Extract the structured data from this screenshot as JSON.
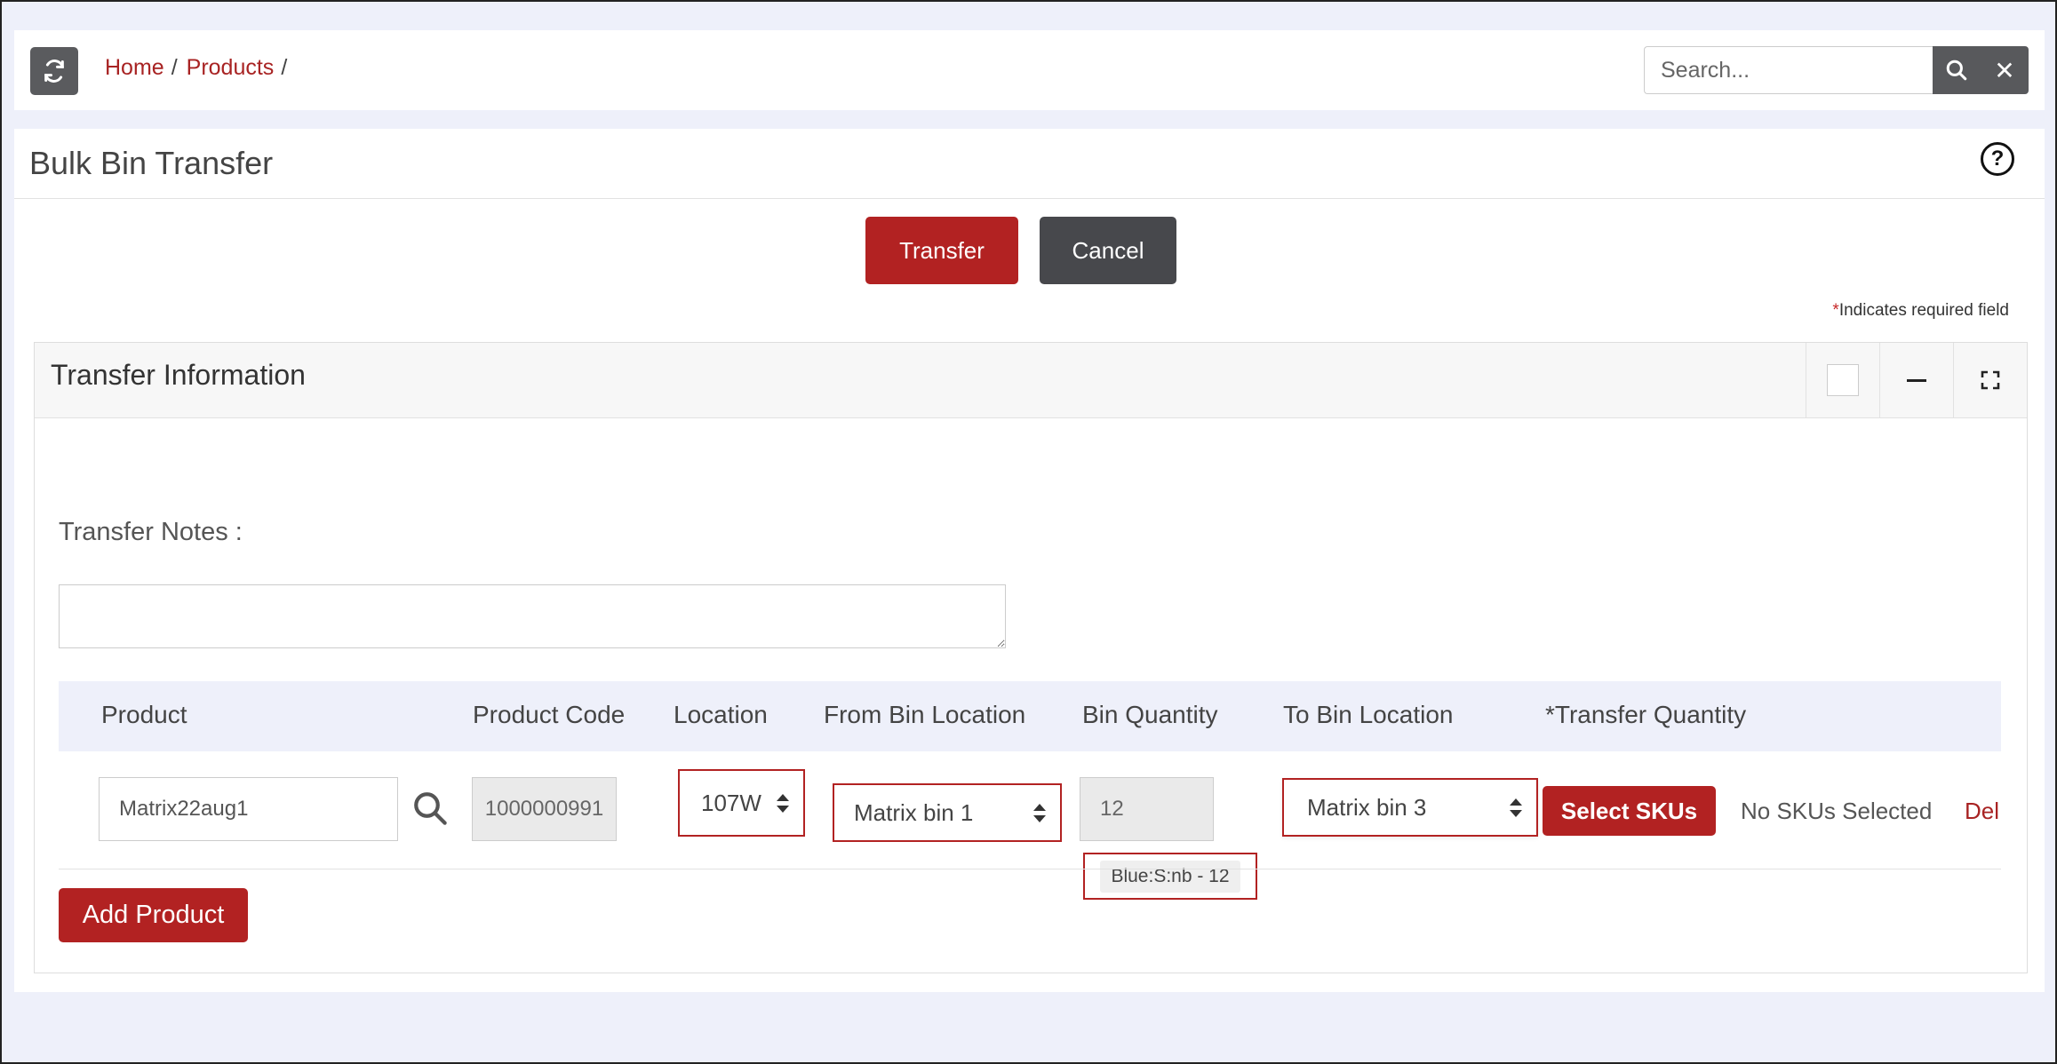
{
  "topbar": {
    "refresh_icon": "refresh-icon",
    "breadcrumb": [
      {
        "label": "Home"
      },
      {
        "label": "Products"
      }
    ],
    "breadcrumb_sep": "/",
    "search": {
      "placeholder": "Search...",
      "value": "",
      "search_icon": "search-icon",
      "close_icon": "close-icon",
      "close_glyph": "✕"
    }
  },
  "page": {
    "title": "Bulk Bin Transfer",
    "help_glyph": "?",
    "actions": {
      "transfer_label": "Transfer",
      "cancel_label": "Cancel"
    },
    "required_star": "*",
    "required_note": "Indicates required field"
  },
  "panel": {
    "title": "Transfer Information",
    "notes_label": "Transfer Notes :",
    "notes_value": "",
    "columns": {
      "product": "Product",
      "product_code": "Product Code",
      "location": "Location",
      "from_bin": "From Bin Location",
      "bin_qty": "Bin Quantity",
      "to_bin": "To Bin Location",
      "transfer_qty": "*Transfer Quantity"
    },
    "row": {
      "product": "Matrix22aug1",
      "product_code": "1000000991",
      "location": "107W",
      "from_bin": "Matrix bin 1",
      "bin_qty": "12",
      "sku_tag": "Blue:S:nb - 12",
      "to_bin": "Matrix bin 3",
      "select_skus_label": "Select SKUs",
      "skus_status": "No SKUs Selected",
      "delete_label": "Del"
    },
    "add_product_label": "Add Product"
  },
  "colors": {
    "accent": "#b22222",
    "dark_button": "#47484c",
    "background": "#eef0fa"
  }
}
